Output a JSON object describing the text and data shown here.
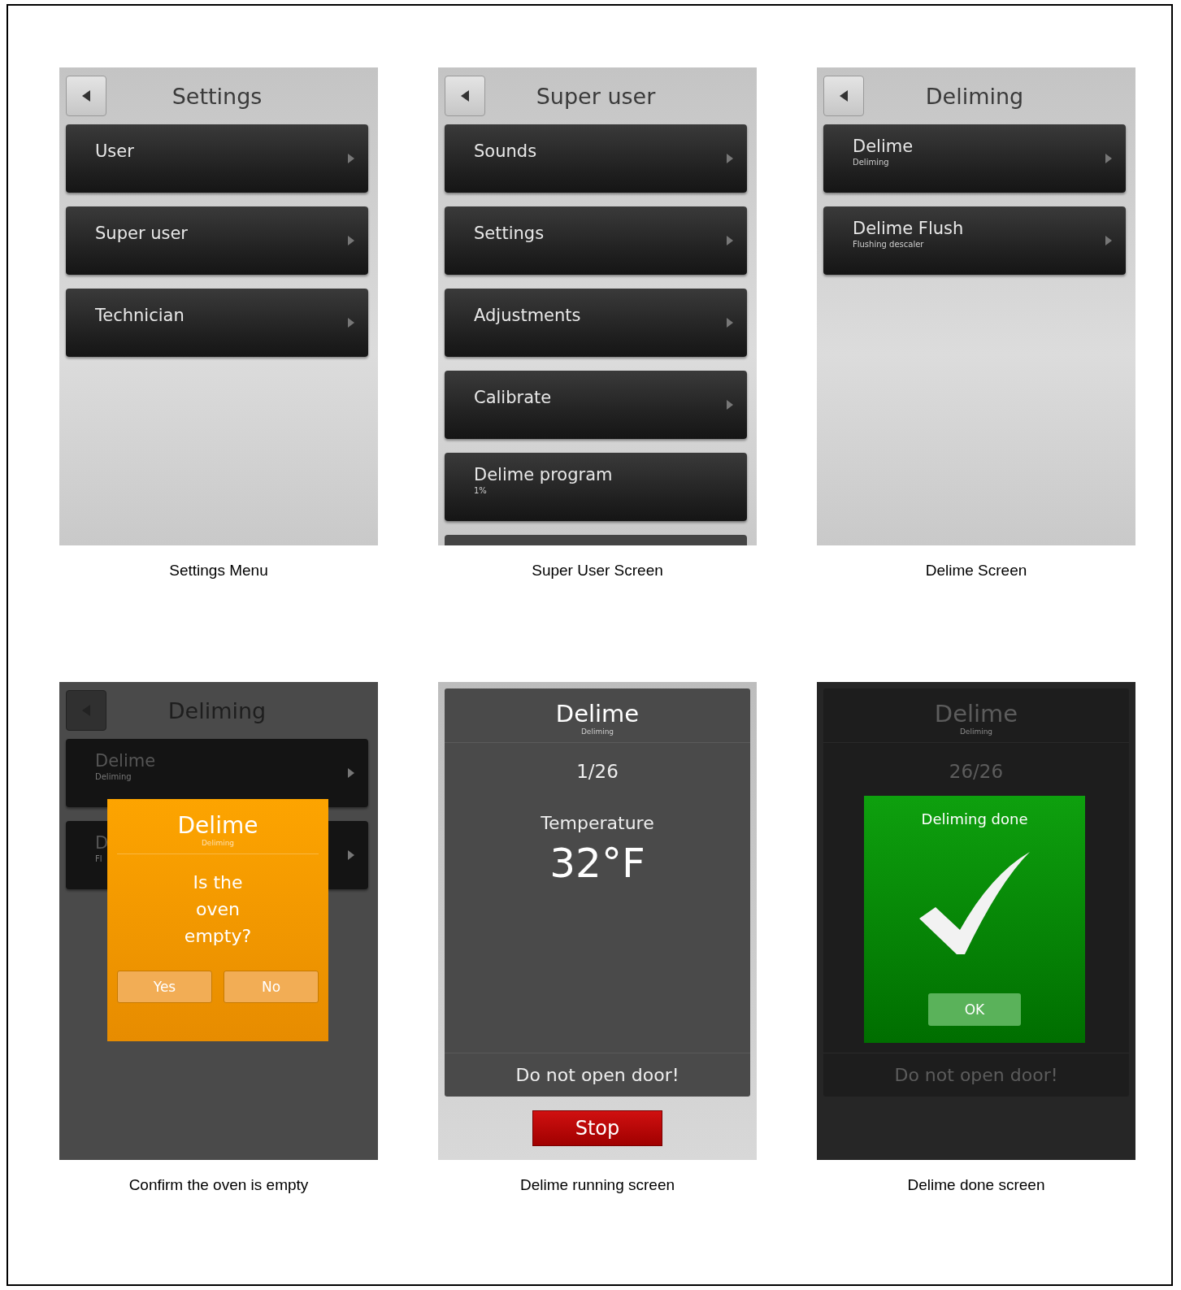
{
  "panels": [
    {
      "kind": "menu",
      "caption": "Settings Menu",
      "title": "Settings",
      "items": [
        {
          "label": "User",
          "arrow": true
        },
        {
          "label": "Super user",
          "arrow": true
        },
        {
          "label": "Technician",
          "arrow": true
        }
      ],
      "more_below": false
    },
    {
      "kind": "menu",
      "caption": "Super User Screen",
      "title": "Super user",
      "items": [
        {
          "label": "Sounds",
          "arrow": true
        },
        {
          "label": "Settings",
          "arrow": true
        },
        {
          "label": "Adjustments",
          "arrow": true
        },
        {
          "label": "Calibrate",
          "arrow": true
        },
        {
          "label": "Delime program",
          "subtitle": "1%",
          "arrow": false
        }
      ],
      "more_below": true
    },
    {
      "kind": "menu",
      "caption": "Delime Screen",
      "title": "Deliming",
      "items": [
        {
          "label": "Delime",
          "subtitle": "Deliming",
          "arrow": true
        },
        {
          "label": "Delime Flush",
          "subtitle": "Flushing descaler",
          "arrow": true
        }
      ],
      "more_below": false
    },
    {
      "kind": "confirm",
      "caption": "Confirm the oven is empty",
      "title": "Deliming",
      "items": [
        {
          "label": "Delime",
          "subtitle": "Deliming",
          "arrow": true
        },
        {
          "label": "D",
          "subtitle": "Fl",
          "arrow": true
        }
      ],
      "dialog": {
        "title": "Delime",
        "subtitle": "Deliming",
        "message": "Is the oven empty?",
        "buttons": [
          "Yes",
          "No"
        ]
      }
    },
    {
      "kind": "running",
      "caption": "Delime running screen",
      "title": "Delime",
      "subtitle": "Deliming",
      "counter": "1/26",
      "label": "Temperature",
      "value": "32°F",
      "footer": "Do not open door!",
      "stop": "Stop"
    },
    {
      "kind": "done",
      "caption": "Delime done screen",
      "title": "Delime",
      "subtitle": "Deliming",
      "counter": "26/26",
      "footer": "Do not open door!",
      "dialog": {
        "title": "Deliming done",
        "button": "OK"
      }
    }
  ]
}
